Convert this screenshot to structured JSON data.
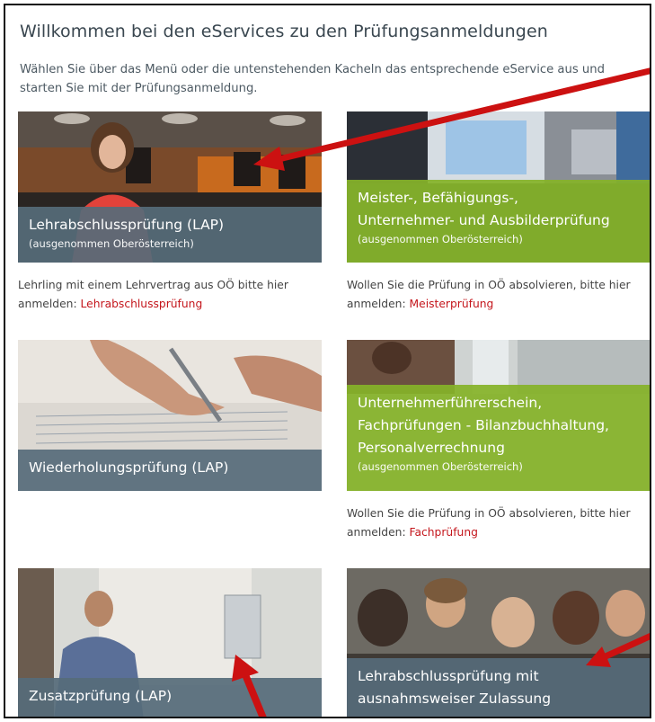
{
  "page": {
    "title": "Willkommen bei den eServices zu den Prüfungsanmeldungen",
    "intro": "Wählen Sie über das Menü oder die untenstehenden Kacheln das entsprechende eService aus und starten Sie mit der Prüfungsanmeldung."
  },
  "tiles": [
    {
      "title": "Lehrabschlussprüfung (LAP)",
      "subtitle": "(ausgenommen Oberösterreich)",
      "note_text": "Lehrling mit einem Lehrvertrag aus OÖ bitte hier anmelden: ",
      "note_link": "Lehrabschlussprüfung"
    },
    {
      "title_line1": "Meister-, Befähigungs-,",
      "title_line2": "Unternehmer- und Ausbilderprüfung",
      "subtitle": "(ausgenommen Oberösterreich)",
      "note_text": "Wollen Sie die Prüfung in OÖ absolvieren, bitte hier anmelden: ",
      "note_link": "Meisterprüfung"
    },
    {
      "title": "Wiederholungsprüfung (LAP)"
    },
    {
      "title_line1": "Unternehmerführerschein,",
      "title_line2": "Fachprüfungen - Bilanzbuchhaltung,",
      "title_line3": "Personalverrechnung",
      "subtitle": "(ausgenommen Oberösterreich)",
      "note_text": "Wollen Sie die Prüfung in OÖ absolvieren, bitte hier anmelden: ",
      "note_link": "Fachprüfung"
    },
    {
      "title": "Zusatzprüfung (LAP)"
    },
    {
      "title_line1": "Lehrabschlussprüfung mit",
      "title_line2": "ausnahmsweiser Zulassung"
    }
  ],
  "colors": {
    "link": "#c4161c",
    "caption_grey": "#566b79",
    "caption_green": "#85b329",
    "annotation_arrow": "#cc1111"
  }
}
